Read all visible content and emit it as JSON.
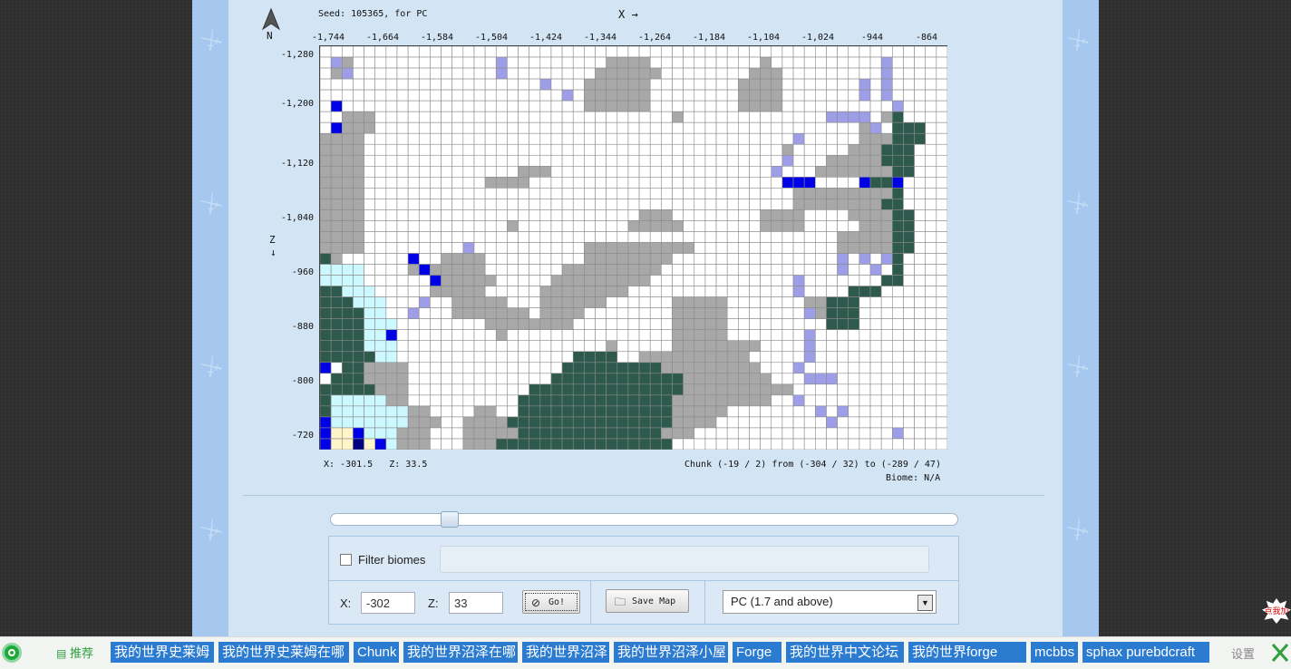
{
  "header": {
    "seed_text": "Seed: 105365, for PC",
    "x_axis_label": "X →",
    "z_axis_label": "Z",
    "compass_label": "N",
    "x_ticks": [
      "-1,744",
      "-1,664",
      "-1,584",
      "-1,504",
      "-1,424",
      "-1,344",
      "-1,264",
      "-1,184",
      "-1,104",
      "-1,024",
      "-944",
      "-864"
    ],
    "z_ticks": [
      "-1,280",
      "-1,200",
      "-1,120",
      "-1,040",
      "-960",
      "-880",
      "-800",
      "-720"
    ]
  },
  "status": {
    "coords": "X: -301.5   Z: 33.5",
    "chunk": "Chunk (-19 / 2) from (-304 / 32) to (-289 / 47)",
    "biome": "Biome: N/A"
  },
  "colors": {
    "white": "#ffffff",
    "gray": "#a8a8a8",
    "darkgreen": "#2d5a4c",
    "lightblue": "#9e9ee8",
    "blue": "#0000e6",
    "navy": "#000080",
    "cyan": "#ccf8ff",
    "sand": "#fff5c8"
  },
  "map": {
    "cols": 57,
    "rows": 37,
    "cells": [
      ".....................................................................",
      ".LG.............L.........GGGG..........G..........L..",
      ".GL.............L........GGGGGG........GGG.........L..",
      "....................L...GGGGGG........GGGG.......L.L...",
      "......................L.GGGGGG........GGGG.......L.L...",
      ".B......................GGGGGG........GGGG..........L..",
      "..GGG...........................G.............LLLL.GD",
      ".BGGG............................................GL.DDD",
      "GGGG.......................................L.....GGGDDD",
      "GGGG......................................G.....GGGDDD",
      "GGGG......................................L...GGGGGDDD",
      "GGGG..............GGG....................L...GGGGGGGDD",
      "GGGG...........GGGG.......................BBB....BDDB",
      "GGGG.......................................GGGGGGGGGD",
      "GGGG.......................................GGGGGGGGDD",
      "GGGG.........................GGG........GGGG....GGGGDD",
      "GGGG.............G..........GGGGG.......GGGG.....GGGDD",
      "GGGG...........................................GGGGGDD",
      "GGGG.........L..........GGGGGGGGGG.............GGGGGDD",
      "DG......B..GGGG.........GGGGGGGG...............L.L.LD",
      "CCCC....GBGGGGG.......GGGGGGGGG................L..L.D",
      "CCCC......BGGGGG.....GGGGGGGGG.............L.......DD",
      "DDCCC.....GGGGG.....GGGGGGGG...............L....DDD",
      "DDDCCC...L..GGGGG...GGGGGG......GGGGG.......GGDDD",
      "DDDDCC..L...GGGGGGG.GGGG........GGGGG.......LGDDD",
      "DDDDCCC........GGGGGGGG.........GGGGG.........DDD",
      "DDDDCCB.........G...............GGGGG.......L....",
      "DDDDCCC...................G.....GGGGGGGG....L.....",
      "DDDDDCC................DDDD..GGGGGGGGGG.....L......",
      "B.DDGGGG..............DDDDDDDDDGGGGGGGGG...L.......",
      ".DDDGGGG.............DDDDDDDDDDDDGGGGGGGG...LLL.....",
      "DDDDDGGG...........DDDDDDDDDDDDDDGGGGGGGGGG.........",
      "DCCCCCGG..........DDDDDDDDDDDDDDGGGGGGGGG..L.......",
      "DCCCCCCCGG....GG..DDDDDDDDDDDDDDGGGGG........L.L......",
      "BCCCCCCCGGG..GGGGDDDDDDDDDDDDDDDGGGG..........L......",
      "BSSBCCCGGG...GGGGGDDDDDDDDDDDDDGGG..................L..",
      "BSSNSBCGGG...GGGDDDDDDDDDDDDDDDD......................"
    ]
  },
  "controls": {
    "slider_position": 0.19,
    "filter_label": "Filter biomes",
    "filter_checked": false,
    "x_label": "X:",
    "x_value": "-302",
    "z_label": "Z:",
    "z_value": "33",
    "go_label": "Go!",
    "save_label": "Save Map",
    "platform_value": "PC (1.7 and above)"
  },
  "bottom_bar": {
    "recommend_label": "推荐",
    "tags": [
      "我的世界史莱姆",
      "我的世界史莱姆在哪",
      "Chunk",
      "我的世界沼泽在哪",
      "我的世界沼泽",
      "我的世界沼泽小屋",
      "Forge",
      "我的世界中文论坛",
      "我的世界forge",
      "mcbbs",
      "sphax purebdcraft"
    ],
    "settings_label": "设置",
    "badge_label": "点我加"
  }
}
